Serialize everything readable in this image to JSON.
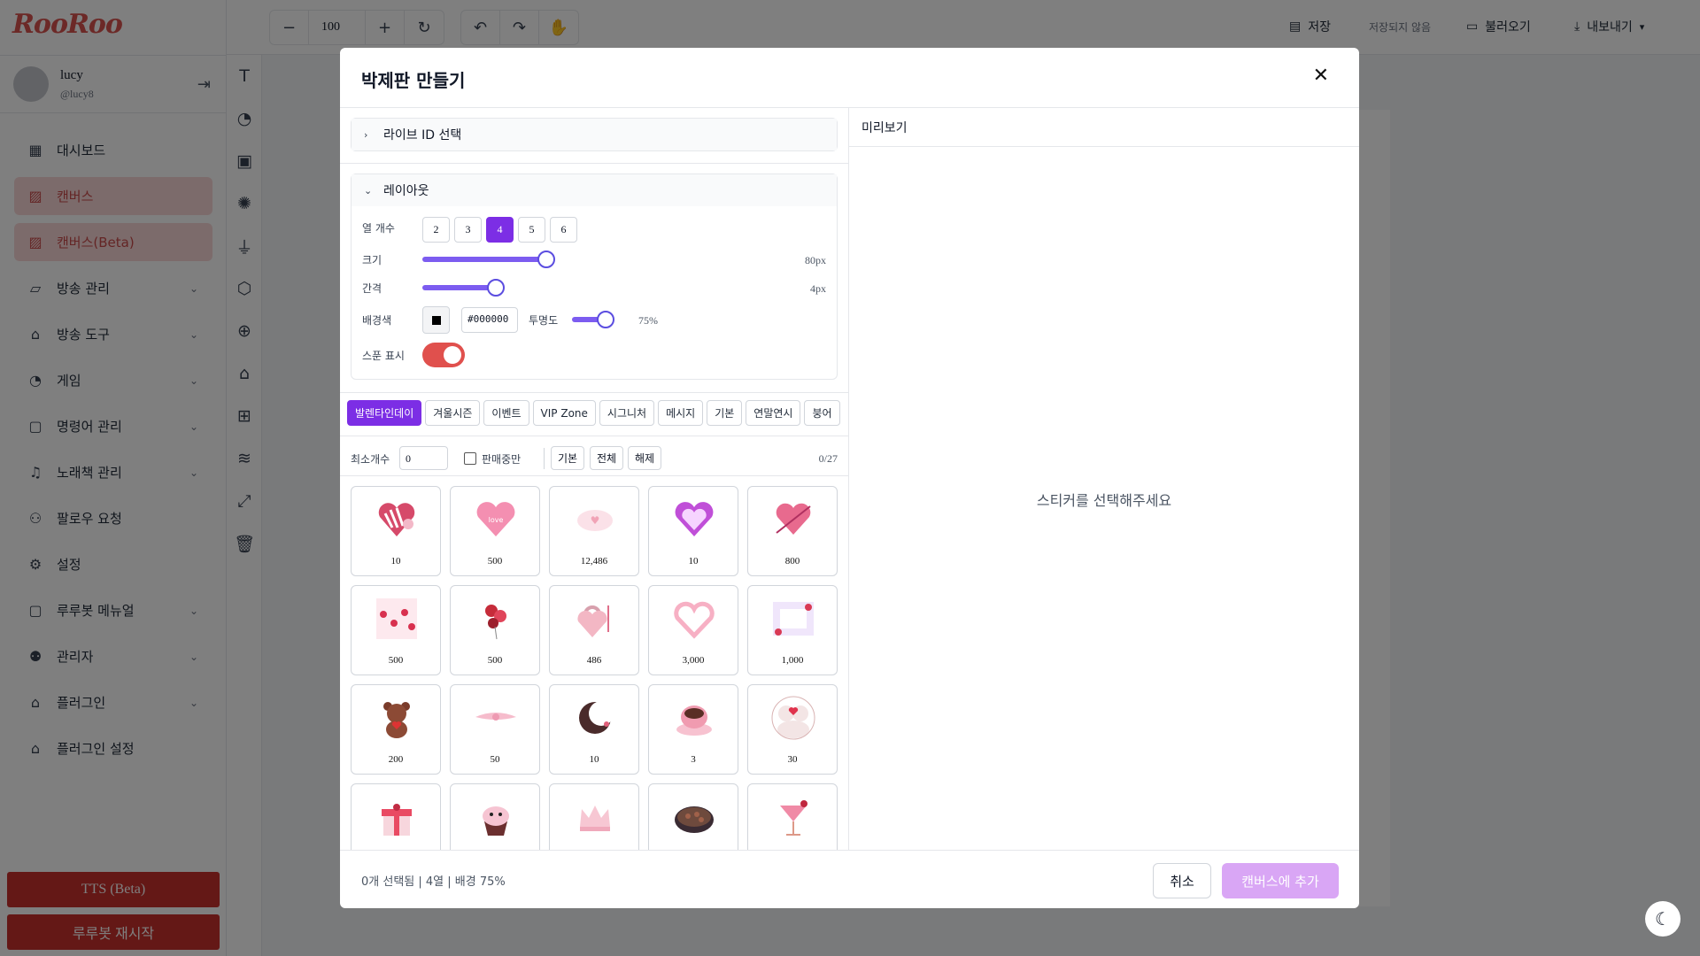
{
  "app": {
    "logo": "RooRoo"
  },
  "user": {
    "name": "lucy",
    "handle": "@lucy8"
  },
  "nav": [
    {
      "label": "대시보드",
      "icon": "dashboard-icon",
      "active": false,
      "expand": false
    },
    {
      "label": "캔버스",
      "icon": "image-edit-icon",
      "active": true,
      "expand": false
    },
    {
      "label": "캔버스(Beta)",
      "icon": "image-edit-icon",
      "active": true,
      "expand": false
    },
    {
      "label": "방송 관리",
      "icon": "broadcast-icon",
      "active": false,
      "expand": true
    },
    {
      "label": "방송 도구",
      "icon": "bot-icon",
      "active": false,
      "expand": true
    },
    {
      "label": "게임",
      "icon": "gauge-icon",
      "active": false,
      "expand": true
    },
    {
      "label": "명령어 관리",
      "icon": "message-icon",
      "active": false,
      "expand": true
    },
    {
      "label": "노래책 관리",
      "icon": "music-icon",
      "active": false,
      "expand": true
    },
    {
      "label": "팔로우 요청",
      "icon": "users-icon",
      "active": false,
      "expand": false
    },
    {
      "label": "설정",
      "icon": "gear-icon",
      "active": false,
      "expand": false
    },
    {
      "label": "루루봇 메뉴얼",
      "icon": "message-icon",
      "active": false,
      "expand": true
    },
    {
      "label": "관리자",
      "icon": "user-cog-icon",
      "active": false,
      "expand": true
    },
    {
      "label": "플러그인",
      "icon": "bot-icon",
      "active": false,
      "expand": true
    },
    {
      "label": "플러그인 설정",
      "icon": "bot-icon",
      "active": false,
      "expand": false
    }
  ],
  "sidebar_buttons": {
    "tts": "TTS (Beta)",
    "restart": "루루봇 재시작"
  },
  "topbar": {
    "zoom": "100",
    "save": "저장",
    "unsaved": "저장되지 않음",
    "load": "불러오기",
    "export": "내보내기"
  },
  "modal": {
    "title": "박제판 만들기",
    "live_id_section": "라이브 ID 선택",
    "layout_section": "레이아웃",
    "labels": {
      "columns": "열 개수",
      "size": "크기",
      "gap": "간격",
      "bg_color": "배경색",
      "opacity": "투명도",
      "show_balloon": "스푼 표시"
    },
    "column_options": [
      "2",
      "3",
      "4",
      "5",
      "6"
    ],
    "selected_columns": "4",
    "size_value": "80px",
    "size_fraction": 0.93,
    "gap_value": "4px",
    "gap_fraction": 0.55,
    "bg_hex": "#000000",
    "opacity_value": "75%",
    "opacity_fraction": 0.75,
    "show_balloon_on": true,
    "tabs": [
      "발렌타인데이",
      "겨울시즌",
      "이벤트",
      "VIP Zone",
      "시그니처",
      "메시지",
      "기본",
      "연말연시",
      "붕어"
    ],
    "selected_tab": "발렌타인데이",
    "filter": {
      "min_count_label": "최소개수",
      "min_count_value": "0",
      "on_sale_label": "판매중만",
      "basic": "기본",
      "all": "전체",
      "clear": "해제",
      "selected_count": "0/27"
    },
    "preview_title": "미리보기",
    "preview_empty": "스티커를 선택해주세요",
    "footer_info": "0개 선택됨 | 4열 | 배경 75%",
    "cancel": "취소",
    "add": "캔버스에 추가"
  },
  "stickers": [
    {
      "price": "10",
      "art": "heart-box"
    },
    {
      "price": "500",
      "art": "love-you-heart"
    },
    {
      "price": "12,486",
      "art": "pink-text"
    },
    {
      "price": "10",
      "art": "purple-heart"
    },
    {
      "price": "800",
      "art": "heart-arrow"
    },
    {
      "price": "500",
      "art": "hanging-hearts"
    },
    {
      "price": "500",
      "art": "balloons"
    },
    {
      "price": "486",
      "art": "heart-lock"
    },
    {
      "price": "3,000",
      "art": "heart-wreath"
    },
    {
      "price": "1,000",
      "art": "love-card"
    },
    {
      "price": "200",
      "art": "teddy-bear"
    },
    {
      "price": "50",
      "art": "pink-ribbon"
    },
    {
      "price": "10",
      "art": "moon-heart"
    },
    {
      "price": "3",
      "art": "coffee-cup"
    },
    {
      "price": "30",
      "art": "bears-couple"
    },
    {
      "price": "",
      "art": "gift-box"
    },
    {
      "price": "",
      "art": "cupcake"
    },
    {
      "price": "",
      "art": "crown"
    },
    {
      "price": "",
      "art": "chocolate-box"
    },
    {
      "price": "",
      "art": "cocktail"
    }
  ]
}
